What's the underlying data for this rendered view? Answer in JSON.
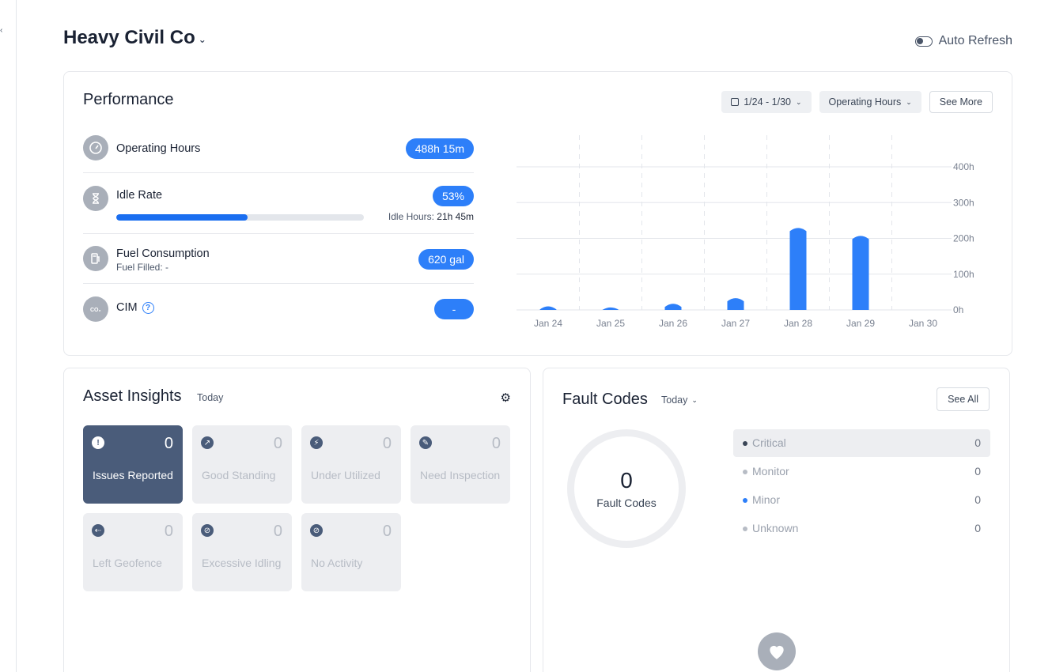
{
  "rail": {
    "collapse_glyph": "‹"
  },
  "header": {
    "org_name": "Heavy Civil Co",
    "auto_refresh_label": "Auto Refresh"
  },
  "performance": {
    "title": "Performance",
    "date_range": "1/24 - 1/30",
    "metric_select": "Operating Hours",
    "see_more": "See More",
    "metrics": {
      "operating_hours": {
        "label": "Operating Hours",
        "value": "488h 15m",
        "icon": "gauge-icon"
      },
      "idle_rate": {
        "label": "Idle Rate",
        "value": "53%",
        "idle_hours_label": "Idle Hours:",
        "idle_hours_value": "21h 45m",
        "progress_fraction": 0.53,
        "icon": "hourglass-icon"
      },
      "fuel": {
        "label": "Fuel Consumption",
        "sub": "Fuel Filled: -",
        "value": "620 gal",
        "icon": "fuel-pump-icon"
      },
      "cim": {
        "label": "CIM",
        "help": "?",
        "value": "-",
        "icon": "co2-icon"
      }
    },
    "colors": {
      "accent": "#2d7ff9",
      "progress": "#1a6ef0",
      "icon_bg": "#a9afb9"
    }
  },
  "chart_data": {
    "type": "bar",
    "categories": [
      "Jan 24",
      "Jan 25",
      "Jan 26",
      "Jan 27",
      "Jan 28",
      "Jan 29",
      "Jan 30"
    ],
    "values": [
      10,
      7,
      17,
      33,
      229,
      207,
      0
    ],
    "yticks": [
      "0h",
      "100h",
      "200h",
      "300h",
      "400h"
    ],
    "ylim": [
      0,
      400
    ],
    "unit": "h",
    "grid": true,
    "color": "#2d7ff9"
  },
  "insights": {
    "title": "Asset Insights",
    "period": "Today",
    "tiles": [
      {
        "label": "Issues Reported",
        "count": "0",
        "icon": "exclamation-icon",
        "glyph": "!",
        "active": true
      },
      {
        "label": "Good Standing",
        "count": "0",
        "icon": "trend-up-icon",
        "glyph": "↗",
        "active": false
      },
      {
        "label": "Under Utilized",
        "count": "0",
        "icon": "lightning-icon",
        "glyph": "⚡",
        "active": false
      },
      {
        "label": "Need Inspection",
        "count": "0",
        "icon": "wrench-icon",
        "glyph": "✎",
        "active": false
      },
      {
        "label": "Left Geofence",
        "count": "0",
        "icon": "exit-icon",
        "glyph": "⇠",
        "active": false
      },
      {
        "label": "Excessive Idling",
        "count": "0",
        "icon": "idle-icon",
        "glyph": "⊘",
        "active": false
      },
      {
        "label": "No Activity",
        "count": "0",
        "icon": "no-activity-icon",
        "glyph": "⊘",
        "active": false
      }
    ]
  },
  "faults": {
    "title": "Fault Codes",
    "period": "Today",
    "see_all": "See All",
    "total": "0",
    "total_label": "Fault Codes",
    "severities": [
      {
        "name": "Critical",
        "count": "0",
        "color": "#3a4556",
        "active": true
      },
      {
        "name": "Monitor",
        "count": "0",
        "color": "#b7bcc5",
        "active": false
      },
      {
        "name": "Minor",
        "count": "0",
        "color": "#2d7ff9",
        "active": false
      },
      {
        "name": "Unknown",
        "count": "0",
        "color": "#b7bcc5",
        "active": false
      }
    ],
    "health_icon": "heart-icon"
  }
}
